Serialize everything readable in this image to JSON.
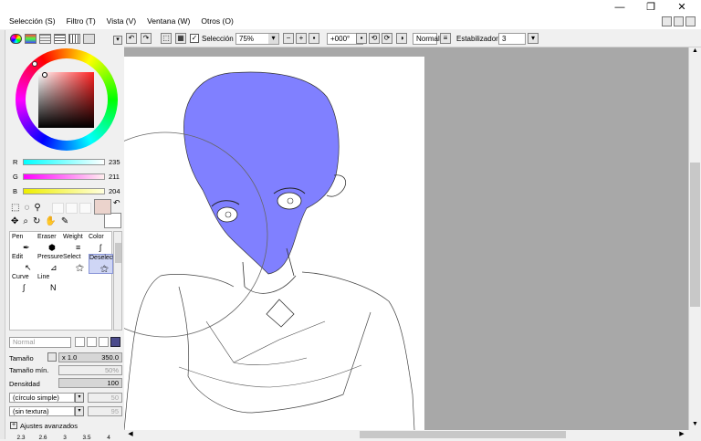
{
  "menu": {
    "items": [
      "Selección (S)",
      "Filtro (T)",
      "Vista (V)",
      "Ventana (W)",
      "Otros (O)"
    ]
  },
  "window": {
    "minimize": "—",
    "restore": "❐",
    "close": "✕"
  },
  "toolbar": {
    "selection_label": "Selección",
    "selection_checked": "✓",
    "zoom": "75%",
    "rotation": "+000°",
    "blend": "Normal",
    "stabilizer_label": "Estabilizador",
    "stabilizer_value": "3"
  },
  "color": {
    "r_label": "R",
    "r_value": "235",
    "g_label": "G",
    "g_value": "211",
    "b_label": "B",
    "b_value": "204",
    "primary": "#ebd3cc",
    "accent": "#8080ff"
  },
  "brush_tools": [
    {
      "label": "Pen"
    },
    {
      "label": "Eraser"
    },
    {
      "label": "Weight"
    },
    {
      "label": "Color"
    },
    {
      "label": "Edit"
    },
    {
      "label": "Pressure"
    },
    {
      "label": "Select"
    },
    {
      "label": "Deselect"
    },
    {
      "label": "Curve"
    },
    {
      "label": "Line"
    }
  ],
  "brush": {
    "mode": "Normal",
    "size_label": "Tamaño",
    "size_mult": "x 1.0",
    "size_value": "350.0",
    "min_size_label": "Tamaño mín.",
    "min_size_value": "50%",
    "density_label": "Densitdad",
    "density_value": "100",
    "shape": "(círculo simple)",
    "shape_value": "50",
    "texture": "(sin textura)",
    "texture_value": "95",
    "advanced": "Ajustes avanzados",
    "presets": [
      "2.3",
      "2.6",
      "3",
      "3.5",
      "4"
    ]
  }
}
